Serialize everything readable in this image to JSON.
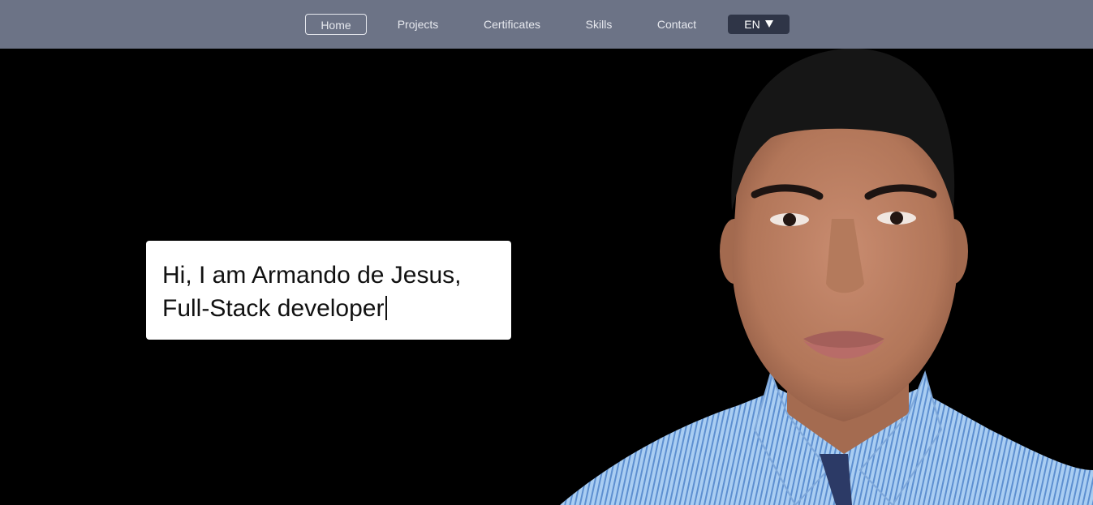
{
  "nav": {
    "items": [
      {
        "label": "Home",
        "active": true
      },
      {
        "label": "Projects",
        "active": false
      },
      {
        "label": "Certificates",
        "active": false
      },
      {
        "label": "Skills",
        "active": false
      },
      {
        "label": "Contact",
        "active": false
      }
    ],
    "language": "EN"
  },
  "hero": {
    "line1": "Hi, I am Armando de Jesus,",
    "line2": "Full-Stack developer"
  },
  "colors": {
    "navbar": "#6c7386",
    "background": "#000000",
    "language_button": "#2f3547",
    "intro_box": "#ffffff",
    "shirt": "#9fc3ea",
    "skin": "#b98066",
    "hair": "#161616"
  }
}
